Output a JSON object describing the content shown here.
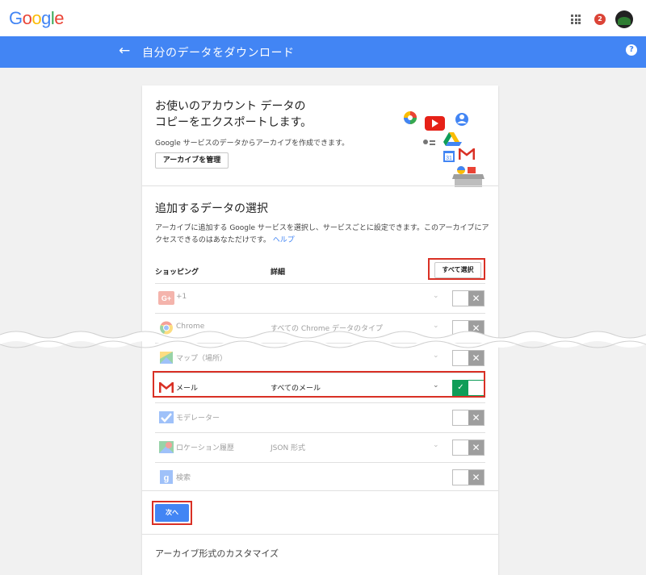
{
  "header": {
    "logo_letters": [
      {
        "ch": "G",
        "color": "#4285f4"
      },
      {
        "ch": "o",
        "color": "#ea4335"
      },
      {
        "ch": "o",
        "color": "#fbbc05"
      },
      {
        "ch": "g",
        "color": "#4285f4"
      },
      {
        "ch": "l",
        "color": "#34a853"
      },
      {
        "ch": "e",
        "color": "#ea4335"
      }
    ],
    "notification_count": "2",
    "apps_icon": "apps-grid-icon",
    "avatar_icon": "account-avatar-icon"
  },
  "bluebar": {
    "back_icon": "back-arrow-icon",
    "back_glyph": "←",
    "title": "自分のデータをダウンロード",
    "help_glyph": "?",
    "color": "#4285f4"
  },
  "hero": {
    "title_line1": "お使いのアカウント データの",
    "title_line2": "コピーをエクスポートします。",
    "description": "Google サービスのデータからアーカイブを作成できます。",
    "manage_button": "アーカイブを管理"
  },
  "select_section": {
    "title": "追加するデータの選択",
    "description": "アーカイブに追加する Google サービスを選択し、サービスごとに設定できます。このアーカイブにアクセスできるのはあなただけです。",
    "help_link": "ヘルプ",
    "col_service": "ショッピング",
    "col_detail": "詳細",
    "select_all_button": "すべて選択"
  },
  "services": [
    {
      "name": "+1",
      "detail": "",
      "has_dropdown": true,
      "enabled": false,
      "icon": "google-plus-icon"
    },
    {
      "name": "Chrome",
      "detail": "すべての Chrome データのタイプ",
      "has_dropdown": true,
      "enabled": false,
      "icon": "chrome-icon"
    },
    {
      "name": "マップ（場所）",
      "detail": "",
      "has_dropdown": true,
      "enabled": false,
      "icon": "maps-icon"
    },
    {
      "name": "メール",
      "detail": "すべてのメール",
      "has_dropdown": true,
      "enabled": true,
      "icon": "gmail-icon"
    },
    {
      "name": "モデレーター",
      "detail": "",
      "has_dropdown": false,
      "enabled": false,
      "icon": "moderator-icon"
    },
    {
      "name": "ロケーション履歴",
      "detail": "JSON 形式",
      "has_dropdown": true,
      "enabled": false,
      "icon": "location-history-icon"
    },
    {
      "name": "検索",
      "detail": "",
      "has_dropdown": false,
      "enabled": false,
      "icon": "search-icon"
    }
  ],
  "toggle_glyphs": {
    "off": "✕",
    "on": "✓"
  },
  "chevron_glyph": "⌄",
  "next_button": "次へ",
  "footer_link": "アーカイブ形式のカスタマイズ",
  "colors": {
    "highlight": "#d93025",
    "toggle_on": "#0f9d58",
    "toggle_off": "#9e9e9e",
    "link": "#4285f4"
  }
}
